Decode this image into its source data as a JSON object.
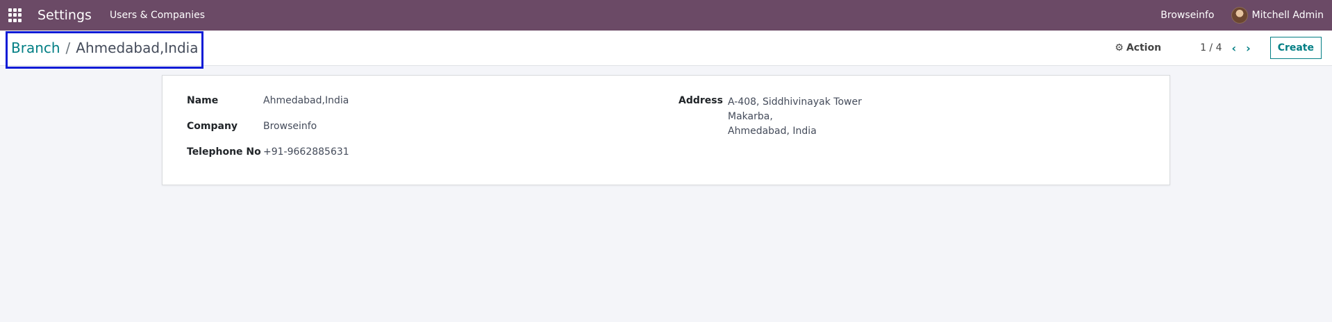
{
  "navbar": {
    "app_title": "Settings",
    "menu": [
      "Users & Companies"
    ],
    "company": "Browseinfo",
    "user": "Mitchell Admin",
    "colors": {
      "bar": "#6b4a66"
    }
  },
  "control_panel": {
    "breadcrumb": {
      "parent": "Branch",
      "separator": "/",
      "current": "Ahmedabad,India"
    },
    "action_label": "Action",
    "pager": "1 / 4",
    "create_label": "Create"
  },
  "form": {
    "name_label": "Name",
    "name_value": "Ahmedabad,India",
    "company_label": "Company",
    "company_value": "Browseinfo",
    "phone_label": "Telephone No",
    "phone_value": "+91-9662885631",
    "address_label": "Address",
    "address_lines": [
      "A-408, Siddhivinayak Tower",
      "Makarba,",
      "Ahmedabad, India"
    ]
  },
  "icons": {
    "apps": "apps-grid-icon",
    "gear": "gear-icon",
    "prev": "chevron-left-icon",
    "next": "chevron-right-icon"
  }
}
